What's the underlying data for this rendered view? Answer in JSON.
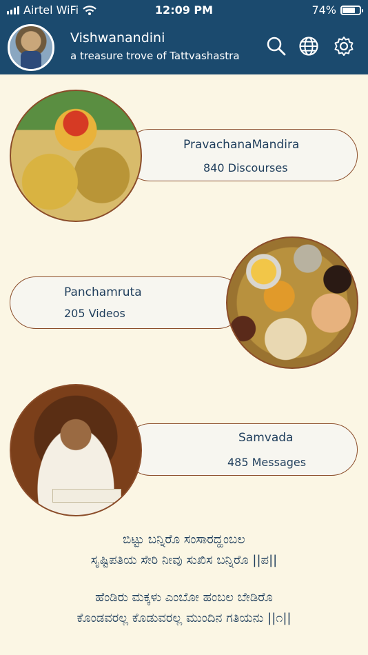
{
  "status": {
    "carrier": "Airtel WiFi",
    "time": "12:09 PM",
    "battery": "74%"
  },
  "header": {
    "title": "Vishwanandini",
    "subtitle": "a treasure trove of Tattvashastra"
  },
  "cards": [
    {
      "name": "PravachanaMandira",
      "count": "840 Discourses"
    },
    {
      "name": "Panchamruta",
      "count": "205 Videos"
    },
    {
      "name": "Samvada",
      "count": "485 Messages"
    }
  ],
  "poem": {
    "lines": [
      "ಬಿಟ್ಟು ಬನ್ನಿರೊ ಸಂಸಾರದ್ಹಂಬಲ",
      "ಸೃಷ್ಟಿಪತಿಯ ಸೇರಿ ನೀವು ಸುಖಿಸ ಬನ್ನಿರೊ ||ಪ||",
      "ಹೆಂಡಿರು ಮಕ್ಕಳು ಎಂಬೋ ಹಂಬಲ ಬೇಡಿರೊ",
      "ಕೊಂಡವರಲ್ಲ ಕೊಡುವರಲ್ಲ ಮುಂದಿನ ಗತಿಯನು ||೧||"
    ]
  },
  "colors": {
    "header": "#1b4a6e",
    "background": "#fbf6e4",
    "accent": "#8b4d2a"
  }
}
